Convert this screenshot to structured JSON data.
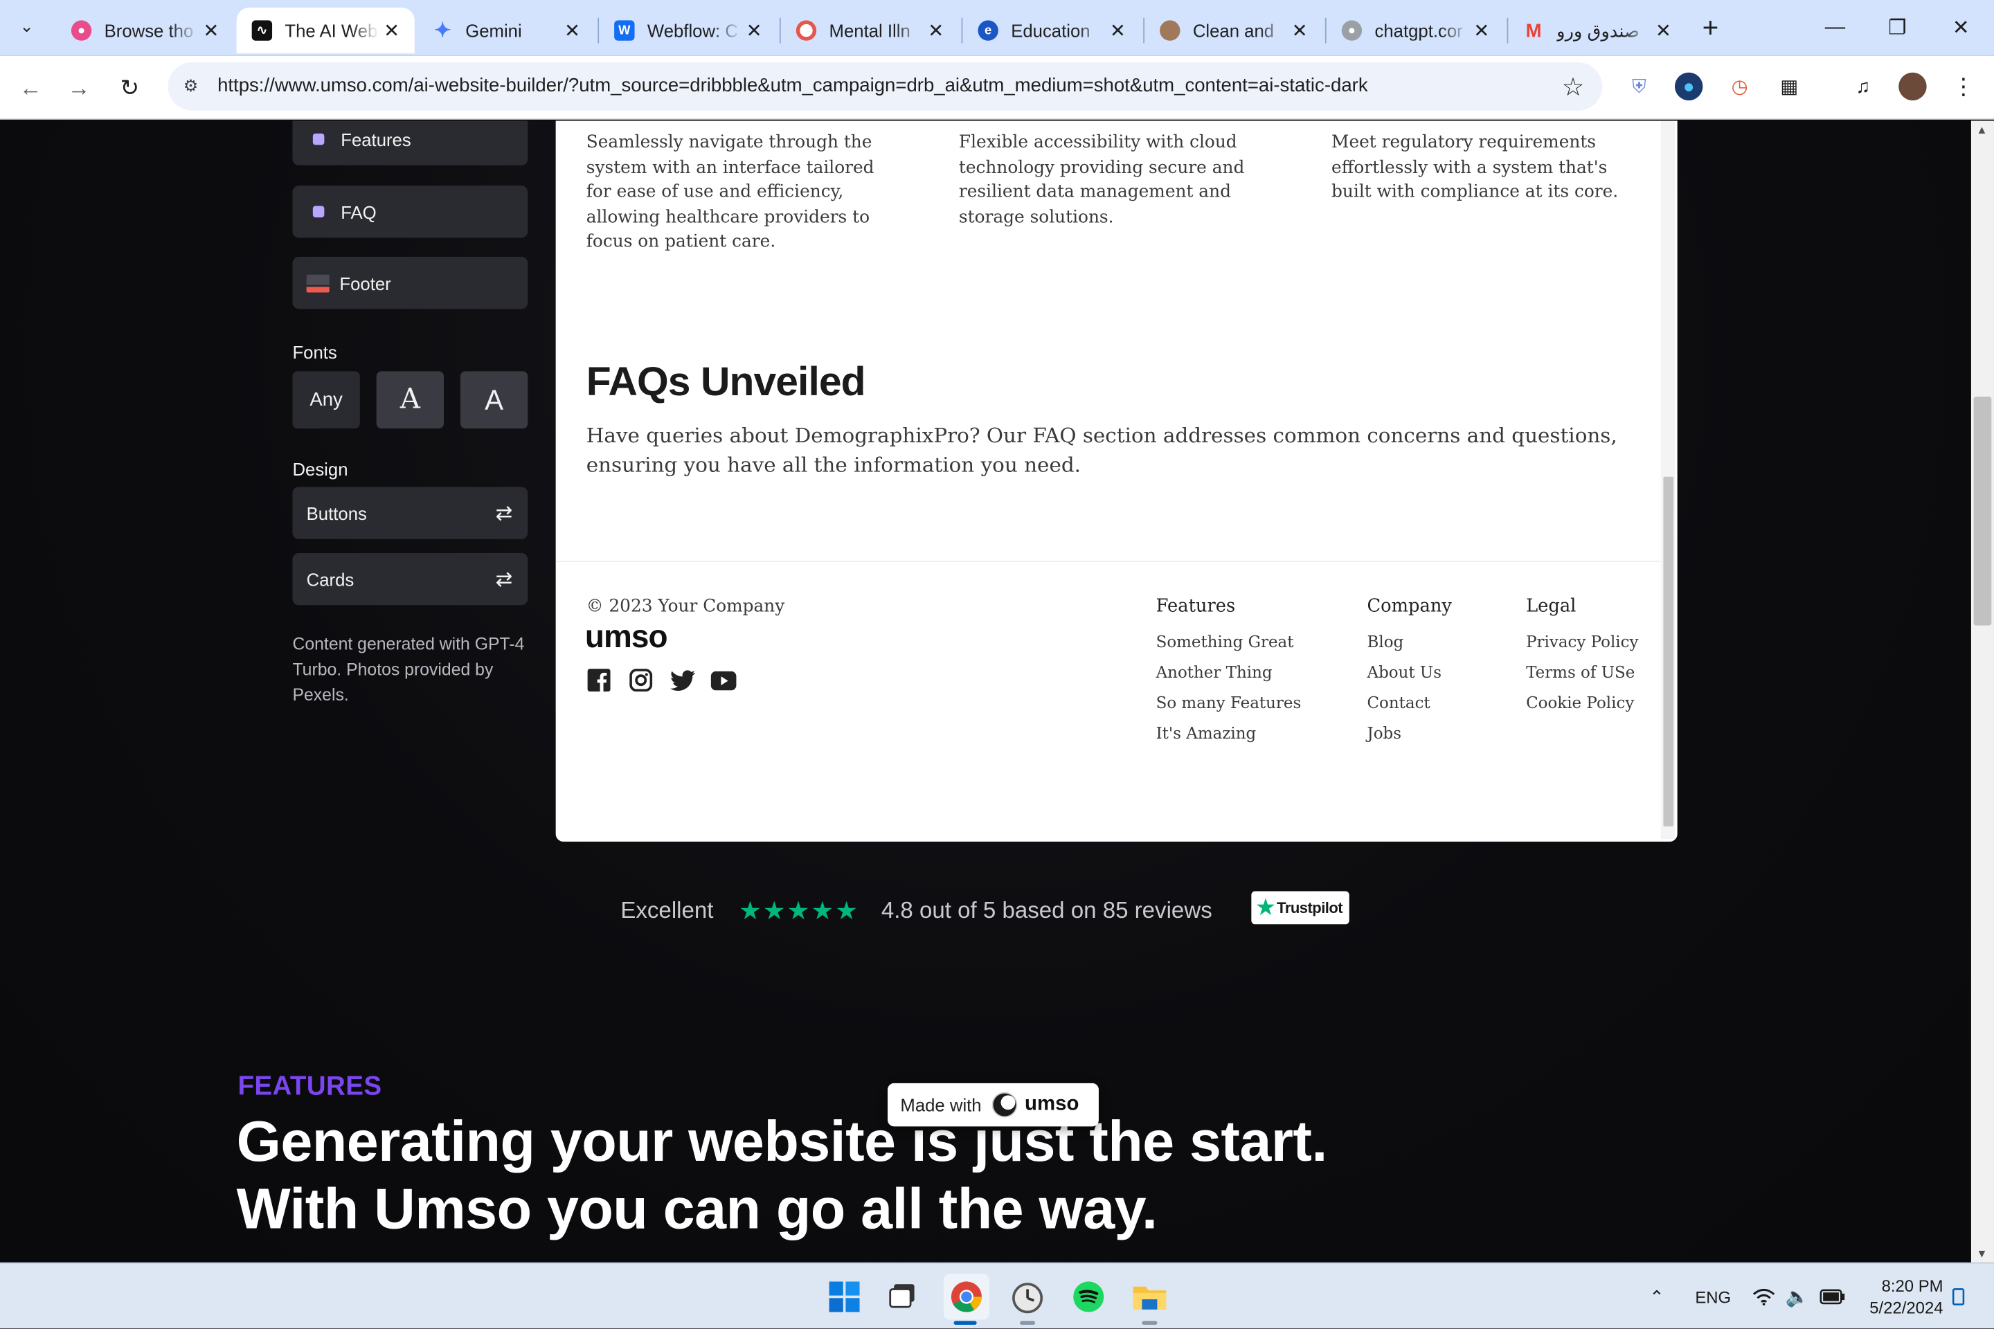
{
  "browser": {
    "tabs": [
      {
        "title": "Browse tho",
        "favicon": "dribbble-icon",
        "color": "#ea4c89"
      },
      {
        "title": "The AI Web",
        "favicon": "umso-icon",
        "color": "#111111",
        "active": true
      },
      {
        "title": "Gemini",
        "favicon": "gemini-icon",
        "color": "#4a7bf7"
      },
      {
        "title": "Webflow: C",
        "favicon": "webflow-icon",
        "color": "#146ef5"
      },
      {
        "title": "Mental Illn",
        "favicon": "target-icon",
        "color": "#e4574c"
      },
      {
        "title": "Education",
        "favicon": "education-icon",
        "color": "#1a56c4"
      },
      {
        "title": "Clean and",
        "favicon": "avatar-icon",
        "color": "#a0785a"
      },
      {
        "title": "chatgpt.cor",
        "favicon": "globe-icon",
        "color": "#5f6368"
      },
      {
        "title": "صندوق ورو",
        "favicon": "gmail-icon",
        "color": "#ea4335"
      }
    ],
    "url": "https://www.umso.com/ai-website-builder/?utm_source=dribbble&utm_campaign=drb_ai&utm_medium=shot&utm_content=ai-static-dark"
  },
  "sidebar": {
    "sections": [
      "Features",
      "FAQ",
      "Footer"
    ],
    "fonts_label": "Fonts",
    "font_options": [
      "Any",
      "A",
      "A"
    ],
    "design_label": "Design",
    "design_options": [
      "Buttons",
      "Cards"
    ],
    "note": "Content generated with GPT-4 Turbo. Photos provided by Pexels."
  },
  "preview": {
    "columns": [
      "Seamlessly navigate through the system with an interface tailored for ease of use and efficiency, allowing healthcare providers to focus on patient care.",
      "Flexible accessibility with cloud technology providing secure and resilient data management and storage solutions.",
      "Meet regulatory requirements effortlessly with a system that's built with compliance at its core."
    ],
    "faq_title": "FAQs Unveiled",
    "faq_desc": "Have queries about DemographixPro? Our FAQ section addresses common concerns and questions, ensuring you have all the information you need.",
    "footer": {
      "copyright": "© 2023 Your Company",
      "logo": "umso",
      "social": [
        "facebook-icon",
        "instagram-icon",
        "twitter-icon",
        "youtube-icon"
      ],
      "columns": [
        {
          "heading": "Features",
          "links": [
            "Something Great",
            "Another Thing",
            "So many Features",
            "It's Amazing"
          ]
        },
        {
          "heading": "Company",
          "links": [
            "Blog",
            "About Us",
            "Contact",
            "Jobs"
          ]
        },
        {
          "heading": "Legal",
          "links": [
            "Privacy Policy",
            "Terms of USe",
            "Cookie Policy"
          ]
        }
      ]
    }
  },
  "trustpilot": {
    "excellent": "Excellent",
    "rating_text": "4.8 out of 5 based on 85 reviews",
    "badge": "Trustpilot",
    "star_color": "#00b67a"
  },
  "features_section": {
    "eyebrow": "FEATURES",
    "heading_line1": "Generating your website is just the start.",
    "heading_line2": "With Umso you can go all the way.",
    "accent": "#7b45f0"
  },
  "made_with": {
    "label": "Made with",
    "brand": "umso"
  },
  "taskbar": {
    "language": "ENG",
    "time": "8:20 PM",
    "date": "5/22/2024"
  }
}
